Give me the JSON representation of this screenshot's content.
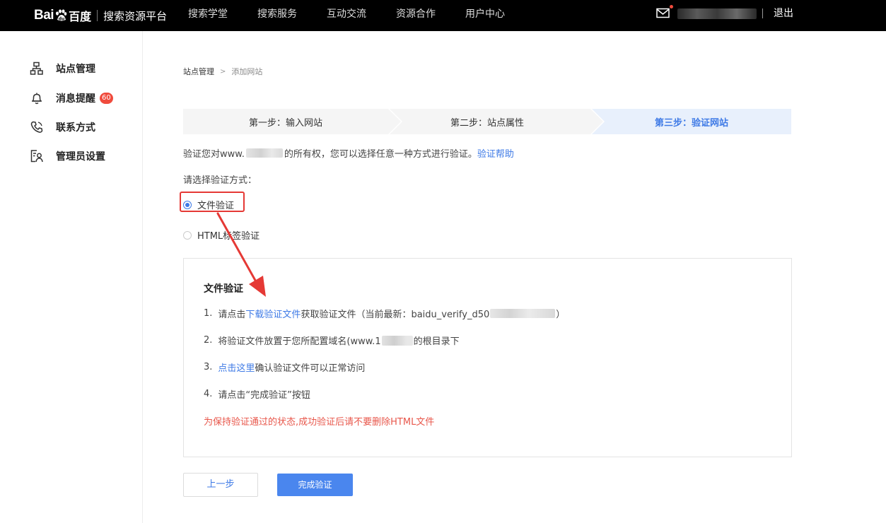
{
  "topbar": {
    "logo_text": "Bai",
    "logo_du": "百度",
    "platform": "搜索资源平台",
    "nav": [
      "搜索学堂",
      "搜索服务",
      "互动交流",
      "资源合作",
      "用户中心"
    ],
    "logout": "退出"
  },
  "sidebar": {
    "items": [
      {
        "label": "站点管理",
        "icon": "sitemap-icon"
      },
      {
        "label": "消息提醒",
        "icon": "bell-icon",
        "badge": "60"
      },
      {
        "label": "联系方式",
        "icon": "phone-icon"
      },
      {
        "label": "管理员设置",
        "icon": "admin-icon"
      }
    ]
  },
  "breadcrumb": {
    "root": "站点管理",
    "separator": ">",
    "current": "添加网站"
  },
  "steps": [
    {
      "label": "第一步：输入网站",
      "active": false
    },
    {
      "label": "第二步：站点属性",
      "active": false
    },
    {
      "label": "第三步：验证网站",
      "active": true
    }
  ],
  "intro": {
    "prefix": "验证您对www.",
    "suffix": "的所有权，您可以选择任意一种方式进行验证。",
    "help_link": "验证帮助"
  },
  "choose_label": "请选择验证方式：",
  "methods": [
    {
      "label": "文件验证",
      "checked": true
    },
    {
      "label": "HTML标签验证",
      "checked": false
    }
  ],
  "panel": {
    "title": "文件验证",
    "step1": {
      "num": "1.",
      "prefix": "请点击",
      "link": "下载验证文件",
      "middle": "获取验证文件（当前最新：baidu_verify_d50",
      "suffix": "）"
    },
    "step2": {
      "num": "2.",
      "prefix": "将验证文件放置于您所配置域名(www.1",
      "suffix": "的根目录下"
    },
    "step3": {
      "num": "3.",
      "link": "点击这里",
      "suffix": "确认验证文件可以正常访问"
    },
    "step4": {
      "num": "4.",
      "text": "请点击“完成验证”按钮"
    },
    "warning": "为保持验证通过的状态,成功验证后请不要删除HTML文件"
  },
  "buttons": {
    "prev": "上一步",
    "done": "完成验证"
  },
  "colors": {
    "accent": "#3e7ae6",
    "primary_button": "#4a86ee",
    "warning": "#e8574b",
    "highlight": "#e53935",
    "active_step_bg": "#e8f0fc"
  }
}
